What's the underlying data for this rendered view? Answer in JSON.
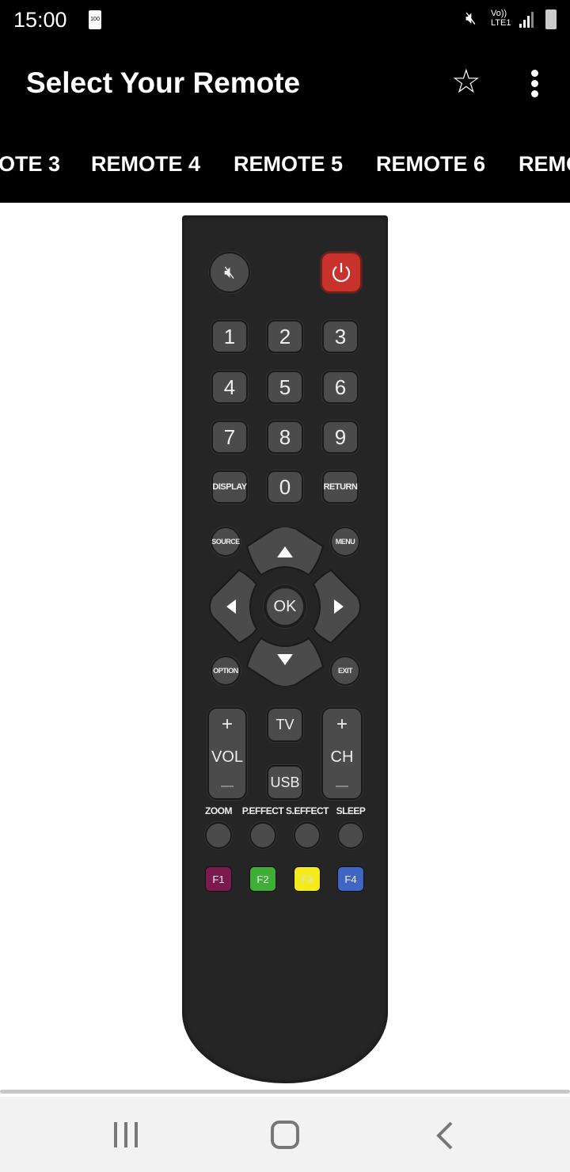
{
  "status": {
    "time": "15:00",
    "battery_badge": "100",
    "network": "Vo)) LTE1"
  },
  "appbar": {
    "title": "Select Your Remote"
  },
  "tabs": [
    "OTE 3",
    "REMOTE 4",
    "REMOTE 5",
    "REMOTE 6",
    "REMO"
  ],
  "remote": {
    "numbers": [
      "1",
      "2",
      "3",
      "4",
      "5",
      "6",
      "7",
      "8",
      "9"
    ],
    "display": "DISPLAY",
    "zero": "0",
    "return": "RETURN",
    "source": "SOURCE",
    "menu": "MENU",
    "option": "OPTION",
    "exit": "EXIT",
    "ok": "OK",
    "vol": "VOL",
    "ch": "CH",
    "plus": "+",
    "minus": "—",
    "tv": "TV",
    "usb": "USB",
    "func_labels": [
      "ZOOM",
      "P.EFFECT",
      "S.EFFECT",
      "SLEEP"
    ],
    "color_keys": [
      {
        "label": "F1",
        "color": "#7a1a4e"
      },
      {
        "label": "F2",
        "color": "#3fae36"
      },
      {
        "label": "F3",
        "color": "#f4ea1c"
      },
      {
        "label": "F4",
        "color": "#3f66c4"
      }
    ],
    "power_color": "#c8322c"
  }
}
